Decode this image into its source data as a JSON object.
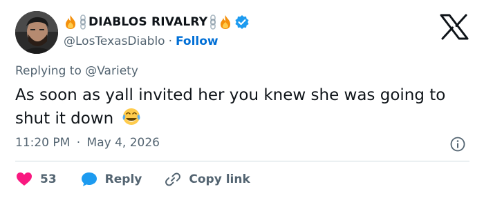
{
  "author": {
    "display_name": "DIABLOS RIVALRY",
    "handle": "@LosTexasDiablo",
    "separator": "·",
    "follow_label": "Follow",
    "verified": true,
    "name_emojis": [
      "fire",
      "chains",
      "chains",
      "fire"
    ]
  },
  "platform_logo": "x-logo",
  "tweet": {
    "replying_prefix": "Replying to",
    "replying_to": "@Variety",
    "text": "As soon as yall invited her you knew she was going to shut it down",
    "trailing_emoji": "face-with-tears-of-joy",
    "time": "11:20 PM",
    "date_separator": "·",
    "date": "May 4, 2026"
  },
  "actions": {
    "like_count": "53",
    "reply_label": "Reply",
    "copy_link_label": "Copy link"
  },
  "colors": {
    "text": "#0f1419",
    "secondary": "#536471",
    "link": "#006fd6",
    "heart": "#f91880",
    "reply_bubble": "#1d9bf0",
    "verified": "#1d9bf0",
    "divider": "#cfd9de"
  }
}
